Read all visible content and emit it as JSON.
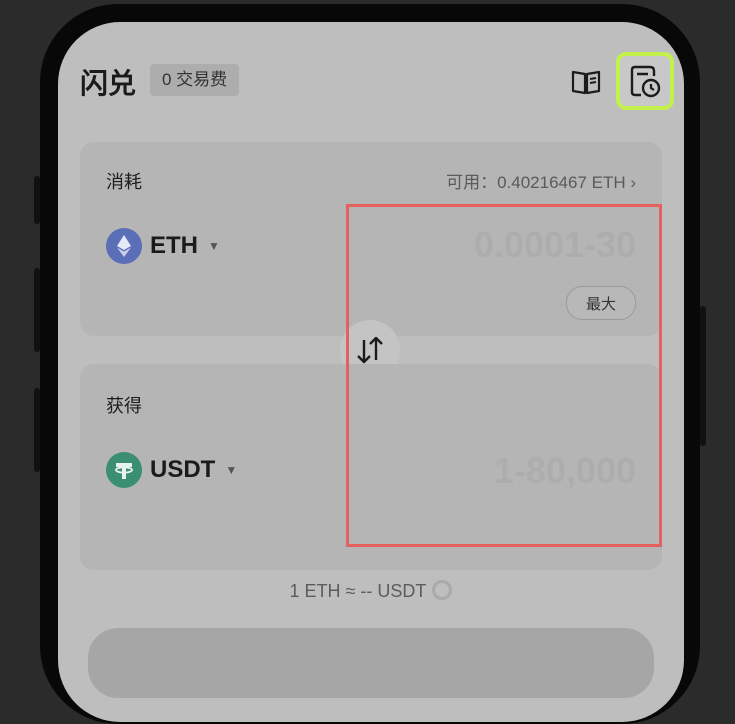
{
  "header": {
    "title": "闪兑",
    "fee_chip": "0 交易费",
    "guide_icon": "book-icon",
    "history_icon": "history-clock-icon"
  },
  "spend": {
    "label": "消耗",
    "available": "可用：0.40216467 ETH ›",
    "token": "ETH",
    "amount_placeholder": "0.0001-30",
    "max_label": "最大"
  },
  "swap_icon": "swap-arrows-icon",
  "receive": {
    "label": "获得",
    "token": "USDT",
    "amount_placeholder": "1-80,000"
  },
  "rate": {
    "text": "1 ETH ≈ -- USDT"
  },
  "colors": {
    "eth": "#5b6fb8",
    "usdt": "#3a8e72",
    "highlight": "#e6605f",
    "focus": "#c4f04c"
  }
}
